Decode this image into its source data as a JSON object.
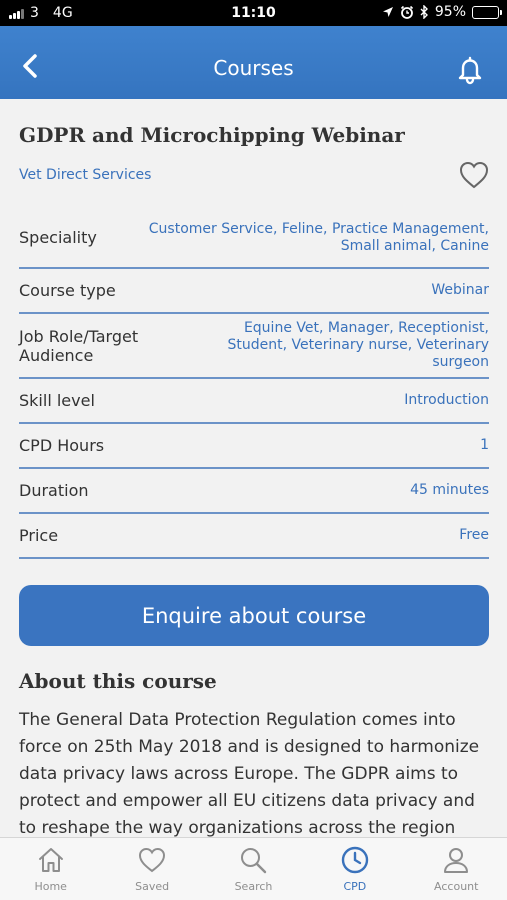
{
  "status_bar": {
    "carrier": "3",
    "network": "4G",
    "time": "11:10",
    "battery": "95%",
    "battery_level": 0.95
  },
  "nav": {
    "title": "Courses",
    "back_icon": "chevron-left-icon",
    "bell_icon": "bell-icon"
  },
  "course": {
    "title": "GDPR and Microchipping Webinar",
    "provider": "Vet Direct Services",
    "saved_icon": "heart-outline-icon",
    "details": [
      {
        "label": "Speciality",
        "value": "Customer Service, Feline, Practice Management, Small animal, Canine"
      },
      {
        "label": "Course type",
        "value": "Webinar"
      },
      {
        "label": "Job Role/Target Audience",
        "value": "Equine Vet, Manager, Receptionist, Student, Veterinary nurse, Veterinary surgeon"
      },
      {
        "label": "Skill level",
        "value": "Introduction"
      },
      {
        "label": "CPD Hours",
        "value": "1"
      },
      {
        "label": "Duration",
        "value": "45 minutes"
      },
      {
        "label": "Price",
        "value": "Free"
      }
    ],
    "enquire_label": "Enquire about course",
    "about_title": "About this course",
    "about_text": "The General Data Protection Regulation comes into force on 25th May 2018 and is designed to harmonize data privacy laws across Europe. The GDPR aims to protect and empower all EU citizens data privacy and to reshape the way organizations across the region approach data"
  },
  "tabs": [
    {
      "label": "Home",
      "icon": "home-icon"
    },
    {
      "label": "Saved",
      "icon": "heart-icon"
    },
    {
      "label": "Search",
      "icon": "search-icon"
    },
    {
      "label": "CPD",
      "icon": "clock-icon"
    },
    {
      "label": "Account",
      "icon": "user-icon"
    }
  ],
  "colors": {
    "primary": "#3a74c0",
    "link": "#3a72bb",
    "divider": "#6c93c8",
    "background": "#f2f2f2"
  }
}
